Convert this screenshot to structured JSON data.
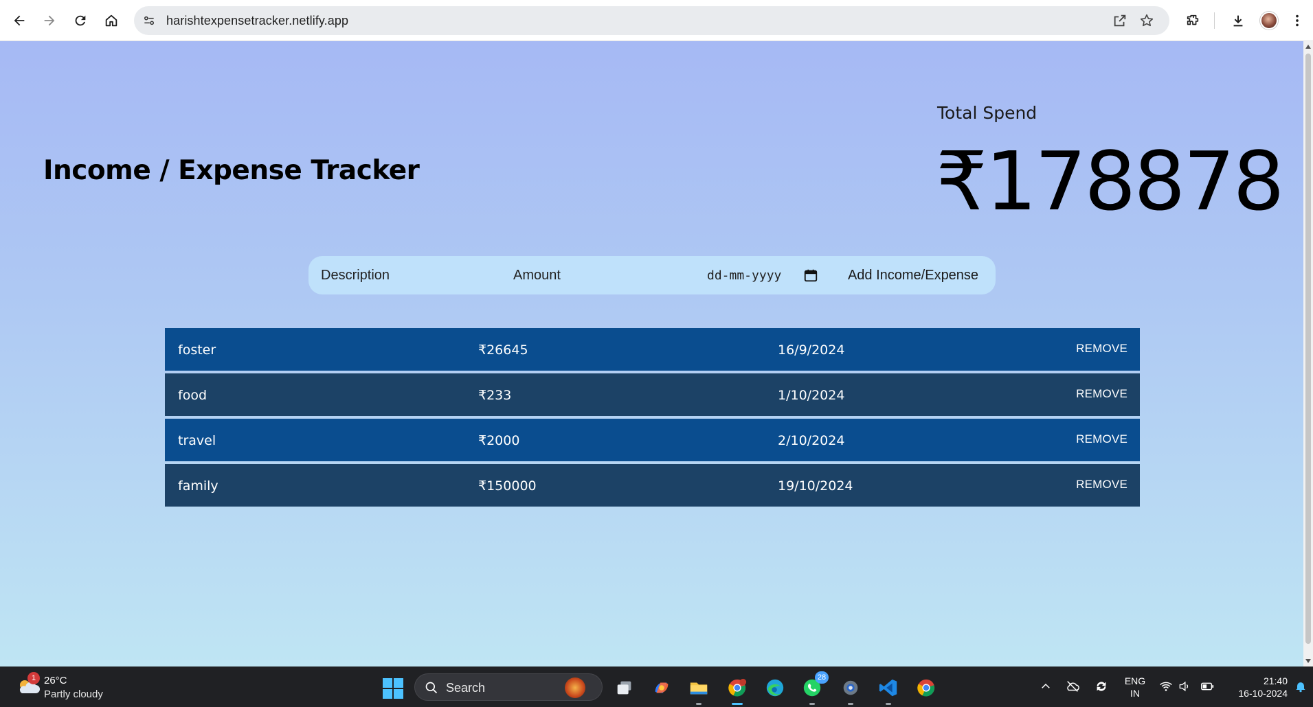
{
  "browser": {
    "url": "harishtexpensetracker.netlify.app"
  },
  "header": {
    "title": "Income / Expense Tracker",
    "total_label": "Total Spend",
    "total_amount": "₹178878"
  },
  "form": {
    "description_placeholder": "Description",
    "amount_placeholder": "Amount",
    "date_placeholder": "dd-mm-yyyy",
    "add_button_label": "Add Income/Expense"
  },
  "transactions": [
    {
      "description": "foster",
      "amount": "₹26645",
      "date": "16/9/2024",
      "remove_label": "REMOVE"
    },
    {
      "description": "food",
      "amount": "₹233",
      "date": "1/10/2024",
      "remove_label": "REMOVE"
    },
    {
      "description": "travel",
      "amount": "₹2000",
      "date": "2/10/2024",
      "remove_label": "REMOVE"
    },
    {
      "description": "family",
      "amount": "₹150000",
      "date": "19/10/2024",
      "remove_label": "REMOVE"
    }
  ],
  "colors": {
    "row_primary": "#0a4d8f",
    "row_secondary": "#1c4266",
    "form_bg": "#bfe1fb",
    "page_gradient_top": "#a6b9f4",
    "page_gradient_bottom": "#bfe5f3"
  },
  "taskbar": {
    "weather_temp": "26°C",
    "weather_condition": "Partly cloudy",
    "weather_badge": "1",
    "search_label": "Search",
    "whatsapp_badge": "28",
    "language_line1": "ENG",
    "language_line2": "IN",
    "time": "21:40",
    "date": "16-10-2024"
  },
  "icons": {
    "browser": [
      "back-arrow-icon",
      "forward-arrow-icon",
      "reload-icon",
      "home-icon",
      "site-info-icon",
      "open-in-app-icon",
      "bookmark-star-icon",
      "extensions-icon",
      "download-icon",
      "profile-avatar",
      "menu-kebab-icon"
    ],
    "taskbar_apps": [
      "task-view-icon",
      "copilot-icon",
      "file-explorer-icon",
      "chrome-profile-icon",
      "edge-icon",
      "whatsapp-icon",
      "settings-icon",
      "vscode-icon",
      "chrome-icon"
    ],
    "tray": [
      "chevron-up-icon",
      "onedrive-icon",
      "sync-icon",
      "wifi-icon",
      "speaker-icon",
      "battery-icon",
      "notification-bell-icon"
    ]
  }
}
